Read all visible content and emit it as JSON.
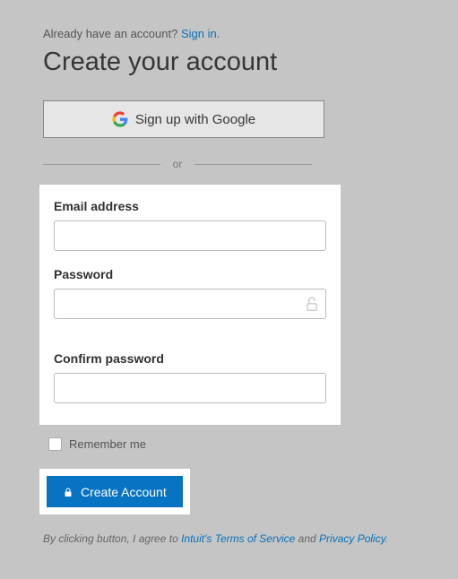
{
  "header": {
    "existing_prompt": "Already have an account? ",
    "signin_link": "Sign in",
    "period": ".",
    "title": "Create your account"
  },
  "google": {
    "label": "Sign up with Google"
  },
  "divider": {
    "text": "or"
  },
  "form": {
    "email_label": "Email address",
    "email_value": "",
    "password_label": "Password",
    "password_value": "",
    "confirm_label": "Confirm password",
    "confirm_value": ""
  },
  "remember": {
    "label": "Remember me",
    "checked": false
  },
  "submit": {
    "label": "Create Account"
  },
  "terms": {
    "prefix": "By clicking button, I agree to ",
    "tos": "Intuit's Terms of Service",
    "middle": " and ",
    "privacy": "Privacy Policy",
    "suffix": "."
  }
}
